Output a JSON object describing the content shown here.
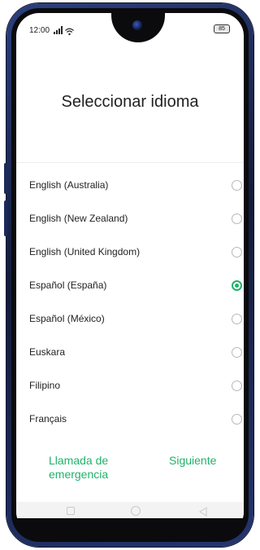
{
  "status_bar": {
    "time": "12:00",
    "signal_icon": "signal-icon",
    "wifi_icon": "wifi-icon",
    "battery_level": "85"
  },
  "title": "Seleccionar idioma",
  "languages": [
    {
      "label": "English (Australia)",
      "selected": false
    },
    {
      "label": "English (New Zealand)",
      "selected": false
    },
    {
      "label": "English (United Kingdom)",
      "selected": false
    },
    {
      "label": "Español (España)",
      "selected": true
    },
    {
      "label": "Español (México)",
      "selected": false
    },
    {
      "label": "Euskara",
      "selected": false
    },
    {
      "label": "Filipino",
      "selected": false
    },
    {
      "label": "Français",
      "selected": false
    }
  ],
  "footer": {
    "emergency_label": "Llamada de emergencia",
    "next_label": "Siguiente"
  },
  "nav_bar": {
    "recents_icon": "square-icon",
    "home_icon": "circle-icon",
    "back_icon": "triangle-back-icon"
  },
  "colors": {
    "accent": "#20b26a",
    "text": "#222222",
    "radio_border": "#b8b8b8"
  }
}
